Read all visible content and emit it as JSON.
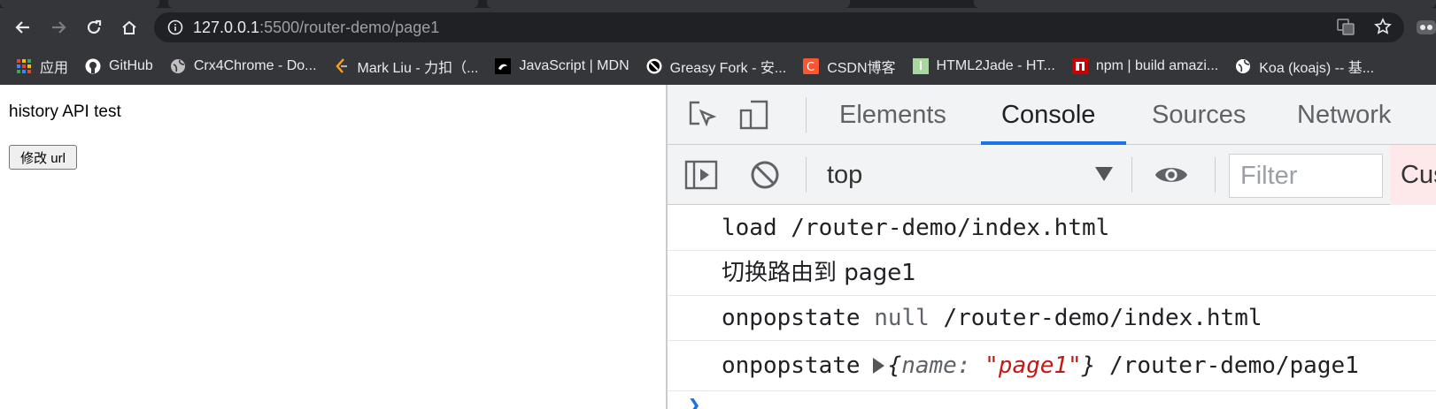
{
  "browser": {
    "url_host": "127.0.0.1",
    "url_path": ":5500/router-demo/page1",
    "bookmarks": [
      {
        "label": "应用",
        "icon": "apps-grid-icon",
        "color": "#ea4335"
      },
      {
        "label": "GitHub",
        "icon": "github-icon",
        "color": "#ffffff"
      },
      {
        "label": "Crx4Chrome - Do...",
        "icon": "globe-icon",
        "color": "#c0c0c0"
      },
      {
        "label": "Mark Liu - 力扣（...",
        "icon": "leetcode-icon",
        "color": "#ffa116"
      },
      {
        "label": "JavaScript | MDN",
        "icon": "mdn-icon",
        "color": "#ffffff"
      },
      {
        "label": "Greasy Fork - 安...",
        "icon": "greasyfork-icon",
        "color": "#ffffff"
      },
      {
        "label": "CSDN博客",
        "icon": "csdn-icon",
        "color": "#fc5531"
      },
      {
        "label": "HTML2Jade - HT...",
        "icon": "html2jade-icon",
        "color": "#a8d8a0"
      },
      {
        "label": "npm | build amazi...",
        "icon": "npm-icon",
        "color": "#cb0000"
      },
      {
        "label": "Koa (koajs) -- 基...",
        "icon": "globe-icon",
        "color": "#ffffff"
      }
    ]
  },
  "page": {
    "heading": "history API test",
    "button_label": "修改 url"
  },
  "devtools": {
    "tabs": [
      "Elements",
      "Console",
      "Sources",
      "Network"
    ],
    "active_tab": "Console",
    "context": "top",
    "filter_placeholder": "Filter",
    "levels_label": "Cus",
    "accent_color": "#1a73e8",
    "console": {
      "line1": "load /router-demo/index.html",
      "line2": "切换路由到 page1",
      "line3_prefix": "onpopstate",
      "line3_null": "null",
      "line3_path": "/router-demo/index.html",
      "line4_prefix": "onpopstate",
      "line4_key": "name:",
      "line4_value": "\"page1\"",
      "line4_path": "/router-demo/page1"
    }
  }
}
